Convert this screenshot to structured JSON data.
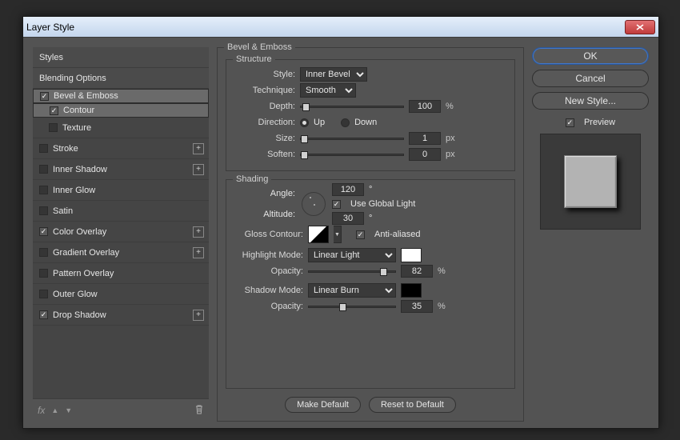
{
  "window": {
    "title": "Layer Style"
  },
  "sidebar": {
    "styles": "Styles",
    "blending": "Blending Options",
    "bevel": "Bevel & Emboss",
    "contour": "Contour",
    "texture": "Texture",
    "stroke": "Stroke",
    "inner_shadow": "Inner Shadow",
    "inner_glow": "Inner Glow",
    "satin": "Satin",
    "color_overlay": "Color Overlay",
    "gradient_overlay": "Gradient Overlay",
    "pattern_overlay": "Pattern Overlay",
    "outer_glow": "Outer Glow",
    "drop_shadow": "Drop Shadow"
  },
  "panel": {
    "title": "Bevel & Emboss",
    "structure": {
      "title": "Structure",
      "style_label": "Style:",
      "style_value": "Inner Bevel",
      "technique_label": "Technique:",
      "technique_value": "Smooth",
      "depth_label": "Depth:",
      "depth_value": "100",
      "depth_unit": "%",
      "direction_label": "Direction:",
      "up": "Up",
      "down": "Down",
      "size_label": "Size:",
      "size_value": "1",
      "size_unit": "px",
      "soften_label": "Soften:",
      "soften_value": "0",
      "soften_unit": "px"
    },
    "shading": {
      "title": "Shading",
      "angle_label": "Angle:",
      "angle_value": "120",
      "angle_unit": "°",
      "use_global": "Use Global Light",
      "altitude_label": "Altitude:",
      "altitude_value": "30",
      "altitude_unit": "°",
      "gloss_label": "Gloss Contour:",
      "anti_aliased": "Anti-aliased",
      "highlight_label": "Highlight Mode:",
      "highlight_value": "Linear Light",
      "highlight_color": "#ffffff",
      "hi_opacity_label": "Opacity:",
      "hi_opacity_value": "82",
      "hi_opacity_unit": "%",
      "shadow_label": "Shadow Mode:",
      "shadow_value": "Linear Burn",
      "shadow_color": "#000000",
      "sh_opacity_label": "Opacity:",
      "sh_opacity_value": "35",
      "sh_opacity_unit": "%"
    },
    "make_default": "Make Default",
    "reset_default": "Reset to Default"
  },
  "right": {
    "ok": "OK",
    "cancel": "Cancel",
    "new_style": "New Style...",
    "preview": "Preview"
  }
}
